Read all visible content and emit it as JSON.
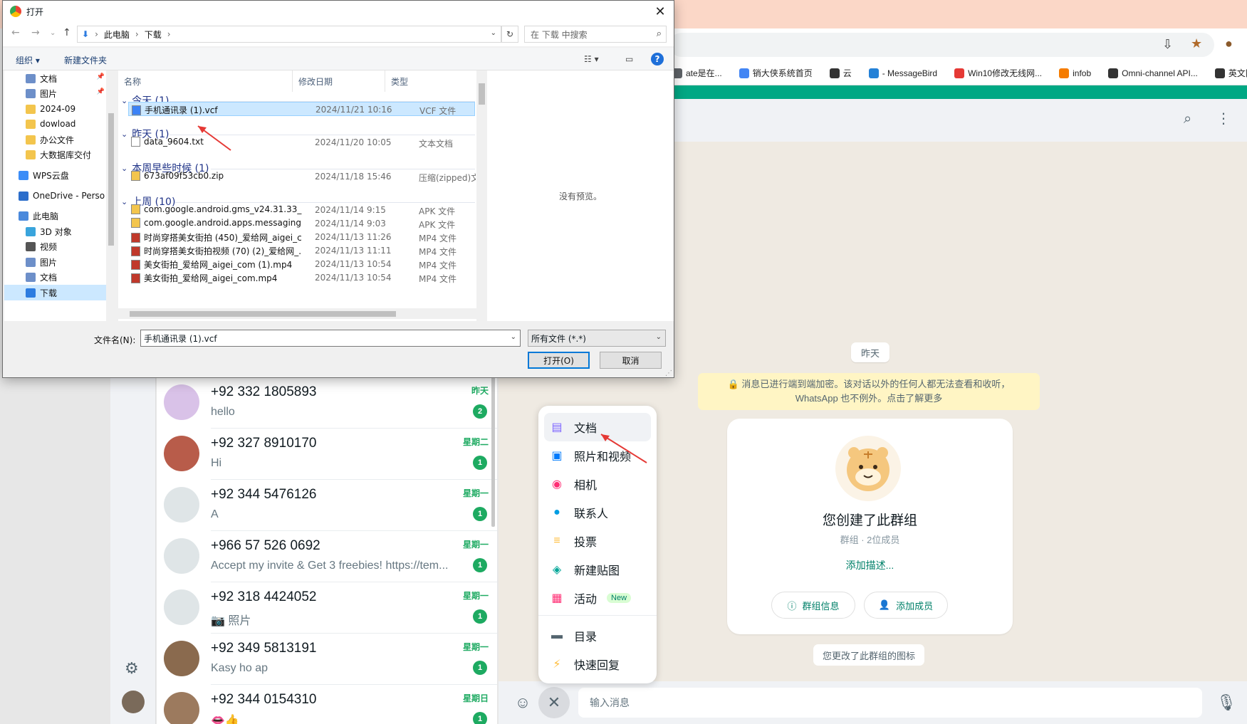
{
  "browser": {
    "bookmarks": [
      {
        "label": "ate是在...",
        "color": "#5f6368"
      },
      {
        "label": "销大侠系统首页",
        "color": "#4285f4"
      },
      {
        "label": "云",
        "color": "#333333"
      },
      {
        "label": "- MessageBird",
        "color": "#2481d7"
      },
      {
        "label": "Win10修改无线网...",
        "color": "#e53935"
      },
      {
        "label": "infob",
        "color": "#f57c00"
      },
      {
        "label": "Omni-channel API...",
        "color": "#333333"
      },
      {
        "label": "英文网",
        "color": "#333333"
      }
    ]
  },
  "dialog": {
    "title": "打开",
    "path": [
      "此电脑",
      "下载"
    ],
    "search_placeholder": "在 下载 中搜索",
    "toolbar": {
      "organize": "组织 ▾",
      "new_folder": "新建文件夹"
    },
    "tree": [
      {
        "label": "文档",
        "color": "#6d8fc9",
        "pinned": true
      },
      {
        "label": "图片",
        "color": "#6d8fc9",
        "pinned": true
      },
      {
        "label": "2024-09",
        "color": "#f3c54d"
      },
      {
        "label": "dowload",
        "color": "#f3c54d"
      },
      {
        "label": "办公文件",
        "color": "#f3c54d"
      },
      {
        "label": "大数据库交付",
        "color": "#f3c54d"
      },
      {
        "label": "WPS云盘",
        "color": "#3c8df7"
      },
      {
        "label": "OneDrive - Perso",
        "color": "#2c6ecb"
      },
      {
        "label": "此电脑",
        "color": "#4a89dc"
      },
      {
        "label": "3D 对象",
        "color": "#39a4dc"
      },
      {
        "label": "视频",
        "color": "#555555"
      },
      {
        "label": "图片",
        "color": "#6d8fc9"
      },
      {
        "label": "文档",
        "color": "#6d8fc9"
      },
      {
        "label": "下载",
        "color": "#2d7ce0",
        "selected": true
      }
    ],
    "columns": {
      "name": "名称",
      "date": "修改日期",
      "type": "类型"
    },
    "groups": [
      {
        "label": "今天 (1)"
      },
      {
        "label": "昨天 (1)"
      },
      {
        "label": "本周早些时候 (1)"
      },
      {
        "label": "上周 (10)"
      }
    ],
    "files": [
      {
        "name": "手机通讯录 (1).vcf",
        "date": "2024/11/21 10:16",
        "type": "VCF 文件",
        "icon_color": "#3b82f6",
        "selected": true
      },
      {
        "name": "data_9604.txt",
        "date": "2024/11/20 10:05",
        "type": "文本文档",
        "icon_color": "#ffffff"
      },
      {
        "name": "673af09f53cb0.zip",
        "date": "2024/11/18 15:46",
        "type": "压缩(zipped)文件",
        "icon_color": "#f3c54d"
      },
      {
        "name": "com.google.android.gms_v24.31.33_(...",
        "date": "2024/11/14 9:15",
        "type": "APK 文件",
        "icon_color": "#f3c54d"
      },
      {
        "name": "com.google.android.apps.messaging...",
        "date": "2024/11/14 9:03",
        "type": "APK 文件",
        "icon_color": "#f3c54d"
      },
      {
        "name": "时尚穿搭美女街拍 (450)_爱给网_aigei_c...",
        "date": "2024/11/13 11:26",
        "type": "MP4 文件",
        "icon_color": "#c0392b"
      },
      {
        "name": "时尚穿搭美女街拍视频 (70) (2)_爱给网_...",
        "date": "2024/11/13 11:11",
        "type": "MP4 文件",
        "icon_color": "#c0392b"
      },
      {
        "name": "美女街拍_爱给网_aigei_com (1).mp4",
        "date": "2024/11/13 10:54",
        "type": "MP4 文件",
        "icon_color": "#c0392b"
      },
      {
        "name": "美女街拍_爱给网_aigei_com.mp4",
        "date": "2024/11/13 10:54",
        "type": "MP4 文件",
        "icon_color": "#c0392b"
      }
    ],
    "preview_text": "没有预览。",
    "filename_label": "文件名(N):",
    "filename_value": "手机通讯录 (1).vcf",
    "filter_value": "所有文件 (*.*)",
    "open_button": "打开(O)",
    "cancel_button": "取消"
  },
  "chat_list": [
    {
      "name": "+92 332 1805893",
      "preview": "hello",
      "time": "昨天",
      "unread": "2",
      "avatar_color": "#d9c2e8"
    },
    {
      "name": "+92 327 8910170",
      "preview": "Hi",
      "time": "星期二",
      "unread": "1",
      "avatar_color": "#b85c4a"
    },
    {
      "name": "+92 344 5476126",
      "preview": "A",
      "time": "星期一",
      "unread": "1",
      "avatar_color": "#dfe5e7"
    },
    {
      "name": "+966 57 526 0692",
      "preview": "Accept my invite & Get 3 freebies! https://tem...",
      "time": "星期一",
      "unread": "1",
      "avatar_color": "#dfe5e7"
    },
    {
      "name": "+92 318 4424052",
      "preview": "📷 照片",
      "time": "星期一",
      "unread": "1",
      "avatar_color": "#dfe5e7"
    },
    {
      "name": "+92 349 5813191",
      "preview": "Kasy ho ap",
      "time": "星期一",
      "unread": "1",
      "avatar_color": "#8a6a4e"
    },
    {
      "name": "+92 344 0154310",
      "preview": "👄👍",
      "time": "星期日",
      "unread": "1",
      "avatar_color": "#9c7a5e"
    }
  ],
  "attach_menu": [
    {
      "label": "文档",
      "icon": "document-icon",
      "color": "#7f66ff",
      "glyph": "▤"
    },
    {
      "label": "照片和视频",
      "icon": "photo-icon",
      "color": "#007bfc",
      "glyph": "▣"
    },
    {
      "label": "相机",
      "icon": "camera-icon",
      "color": "#ff2e74",
      "glyph": "◉"
    },
    {
      "label": "联系人",
      "icon": "contact-icon",
      "color": "#009de2",
      "glyph": "●"
    },
    {
      "label": "投票",
      "icon": "poll-icon",
      "color": "#ffbc38",
      "glyph": "≡"
    },
    {
      "label": "新建贴图",
      "icon": "sticker-icon",
      "color": "#02a698",
      "glyph": "◈"
    },
    {
      "label": "活动",
      "icon": "event-icon",
      "color": "#ff2e74",
      "glyph": "▦",
      "badge": "New"
    },
    {
      "label": "目录",
      "icon": "catalog-icon",
      "color": "#54656f",
      "glyph": "▬"
    },
    {
      "label": "快速回复",
      "icon": "quick-reply-icon",
      "color": "#ffbc38",
      "glyph": "⚡"
    }
  ],
  "chat": {
    "date_chip": "昨天",
    "encryption_note": "🔒 消息已进行端到端加密。该对话以外的任何人都无法查看和收听，WhatsApp 也不例外。点击了解更多",
    "group_title": "您创建了此群组",
    "group_sub": "群组 · 2位成员",
    "add_description": "添加描述...",
    "group_info_button": "群组信息",
    "add_member_button": "添加成员",
    "changed_icon_note": "您更改了此群组的图标",
    "input_placeholder": "输入消息"
  }
}
